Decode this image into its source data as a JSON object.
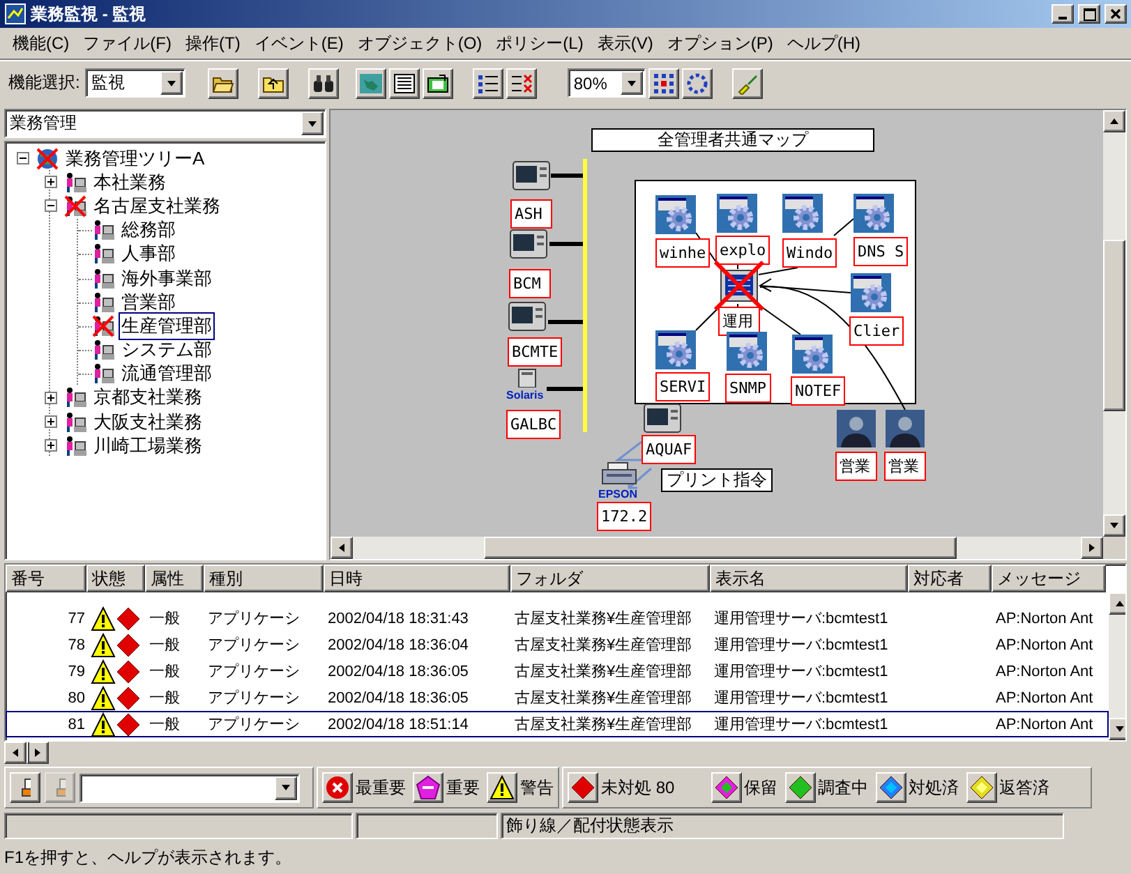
{
  "window": {
    "title": "業務監視 - 監視"
  },
  "menu": [
    "機能(C)",
    "ファイル(F)",
    "操作(T)",
    "イベント(E)",
    "オブジェクト(O)",
    "ポリシー(L)",
    "表示(V)",
    "オプション(P)",
    "ヘルプ(H)"
  ],
  "toolbar": {
    "function_label": "機能選択:",
    "function_value": "監視",
    "zoom_value": "80%"
  },
  "tree": {
    "selector": "業務管理",
    "items": [
      {
        "kind": "globe",
        "label": "業務管理ツリーA",
        "error": true,
        "expanded": true,
        "selected": false,
        "children": [
          {
            "kind": "department",
            "label": "本社業務",
            "error": false,
            "expanded": false,
            "selected": false
          },
          {
            "kind": "department",
            "label": "名古屋支社業務",
            "error": true,
            "expanded": true,
            "selected": false,
            "children": [
              {
                "kind": "department",
                "label": "総務部",
                "error": false,
                "selected": false
              },
              {
                "kind": "department",
                "label": "人事部",
                "error": false,
                "selected": false
              },
              {
                "kind": "department",
                "label": "海外事業部",
                "error": false,
                "selected": false
              },
              {
                "kind": "department",
                "label": "営業部",
                "error": false,
                "selected": false
              },
              {
                "kind": "department",
                "label": "生産管理部",
                "error": true,
                "selected": true
              },
              {
                "kind": "department",
                "label": "システム部",
                "error": false,
                "selected": false
              },
              {
                "kind": "department",
                "label": "流通管理部",
                "error": false,
                "selected": false
              }
            ]
          },
          {
            "kind": "department",
            "label": "京都支社業務",
            "error": false,
            "expanded": false,
            "selected": false
          },
          {
            "kind": "department",
            "label": "大阪支社業務",
            "error": false,
            "expanded": false,
            "selected": false
          },
          {
            "kind": "department",
            "label": "川崎工場業務",
            "error": false,
            "expanded": false,
            "selected": false
          }
        ]
      }
    ]
  },
  "map": {
    "title": "全管理者共通マップ",
    "note": "プリント指令",
    "nodes": [
      {
        "kind": "computer",
        "label": "ASH",
        "error": false
      },
      {
        "kind": "computer",
        "label": "BCM",
        "error": false
      },
      {
        "kind": "computer",
        "label": "BCMTE",
        "error": false
      },
      {
        "kind": "tower",
        "label": "GALBC",
        "logo": "Solaris",
        "error": false
      },
      {
        "kind": "gear",
        "label": "winhe",
        "error": false
      },
      {
        "kind": "gear",
        "label": "explo",
        "error": false
      },
      {
        "kind": "gear",
        "label": "Windo",
        "error": false
      },
      {
        "kind": "gear",
        "label": "DNS S",
        "error": false
      },
      {
        "kind": "server",
        "label": "運用",
        "error": true
      },
      {
        "kind": "gear",
        "label": "Clier",
        "error": false
      },
      {
        "kind": "gear",
        "label": "SERVI",
        "error": false
      },
      {
        "kind": "gear",
        "label": "SNMP",
        "error": false
      },
      {
        "kind": "gear",
        "label": "NOTEF",
        "error": false
      },
      {
        "kind": "computer",
        "label": "AQUAF",
        "error": false
      },
      {
        "kind": "person",
        "label": "営業",
        "error": false
      },
      {
        "kind": "person",
        "label": "営業",
        "error": false
      },
      {
        "kind": "printer",
        "label": "172.2",
        "logo": "EPSON",
        "error": false
      }
    ]
  },
  "events": {
    "columns": [
      "番号",
      "状態",
      "属性",
      "種別",
      "日時",
      "フォルダ",
      "表示名",
      "対応者",
      "メッセージ"
    ],
    "rows": [
      {
        "number": "77",
        "icons": [
          {
            "kind": "warning"
          },
          {
            "kind": "unhandled"
          }
        ],
        "category": "一般",
        "type": "アプリケーシ",
        "datetime": "2002/04/18 18:31:43",
        "folder": "古屋支社業務¥生産管理部",
        "display_name": "運用管理サーバ:bcmtest1",
        "message": "AP:Norton Ant",
        "selected": false
      },
      {
        "number": "78",
        "icons": [
          {
            "kind": "warning"
          },
          {
            "kind": "unhandled"
          }
        ],
        "category": "一般",
        "type": "アプリケーシ",
        "datetime": "2002/04/18 18:36:04",
        "folder": "古屋支社業務¥生産管理部",
        "display_name": "運用管理サーバ:bcmtest1",
        "message": "AP:Norton Ant",
        "selected": false
      },
      {
        "number": "79",
        "icons": [
          {
            "kind": "warning"
          },
          {
            "kind": "unhandled"
          }
        ],
        "category": "一般",
        "type": "アプリケーシ",
        "datetime": "2002/04/18 18:36:05",
        "folder": "古屋支社業務¥生産管理部",
        "display_name": "運用管理サーバ:bcmtest1",
        "message": "AP:Norton Ant",
        "selected": false
      },
      {
        "number": "80",
        "icons": [
          {
            "kind": "warning"
          },
          {
            "kind": "unhandled"
          }
        ],
        "category": "一般",
        "type": "アプリケーシ",
        "datetime": "2002/04/18 18:36:05",
        "folder": "古屋支社業務¥生産管理部",
        "display_name": "運用管理サーバ:bcmtest1",
        "message": "AP:Norton Ant",
        "selected": false
      },
      {
        "number": "81",
        "icons": [
          {
            "kind": "warning"
          },
          {
            "kind": "unhandled"
          }
        ],
        "category": "一般",
        "type": "アプリケーシ",
        "datetime": "2002/04/18 18:51:14",
        "folder": "古屋支社業務¥生産管理部",
        "display_name": "運用管理サーバ:bcmtest1",
        "message": "AP:Norton Ant",
        "selected": true
      }
    ]
  },
  "filter_bar": {
    "tools": [
      {
        "disabled": false
      },
      {
        "disabled": true
      }
    ],
    "severity_filters": [
      {
        "kind": "critical",
        "label": "最重要"
      },
      {
        "kind": "major",
        "label": "重要"
      },
      {
        "kind": "warning",
        "label": "警告"
      }
    ],
    "status_filters": [
      {
        "kind": "unhandled",
        "label": "未対処 80"
      },
      {
        "kind": "hold",
        "label": "保留"
      },
      {
        "kind": "investigating",
        "label": "調査中"
      },
      {
        "kind": "handled",
        "label": "対処済"
      },
      {
        "kind": "replied",
        "label": "返答済"
      }
    ]
  },
  "status_bar": {
    "text": "飾り線／配付状態表示"
  },
  "hint": "F1を押すと、ヘルプが表示されます。"
}
